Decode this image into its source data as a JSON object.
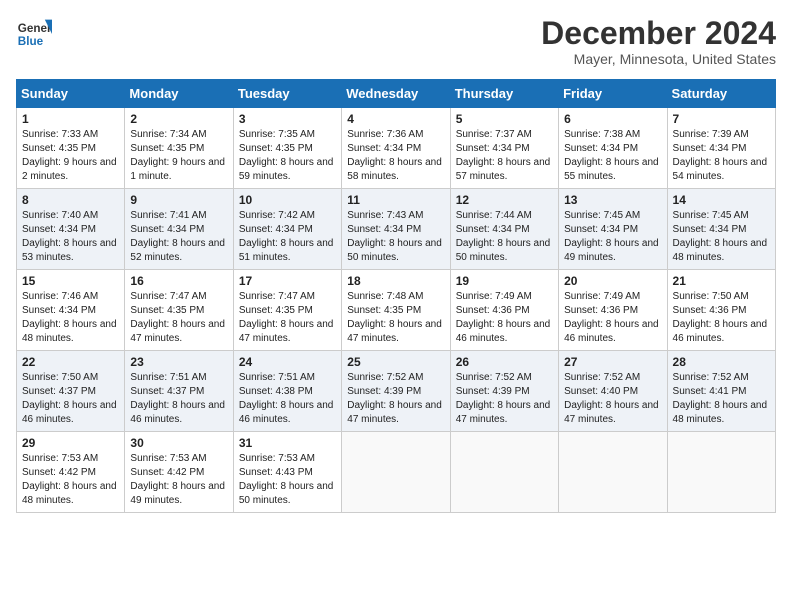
{
  "header": {
    "logo_line1": "General",
    "logo_line2": "Blue",
    "title": "December 2024",
    "subtitle": "Mayer, Minnesota, United States"
  },
  "weekdays": [
    "Sunday",
    "Monday",
    "Tuesday",
    "Wednesday",
    "Thursday",
    "Friday",
    "Saturday"
  ],
  "weeks": [
    [
      {
        "day": "1",
        "sunrise": "Sunrise: 7:33 AM",
        "sunset": "Sunset: 4:35 PM",
        "daylight": "Daylight: 9 hours and 2 minutes."
      },
      {
        "day": "2",
        "sunrise": "Sunrise: 7:34 AM",
        "sunset": "Sunset: 4:35 PM",
        "daylight": "Daylight: 9 hours and 1 minute."
      },
      {
        "day": "3",
        "sunrise": "Sunrise: 7:35 AM",
        "sunset": "Sunset: 4:35 PM",
        "daylight": "Daylight: 8 hours and 59 minutes."
      },
      {
        "day": "4",
        "sunrise": "Sunrise: 7:36 AM",
        "sunset": "Sunset: 4:34 PM",
        "daylight": "Daylight: 8 hours and 58 minutes."
      },
      {
        "day": "5",
        "sunrise": "Sunrise: 7:37 AM",
        "sunset": "Sunset: 4:34 PM",
        "daylight": "Daylight: 8 hours and 57 minutes."
      },
      {
        "day": "6",
        "sunrise": "Sunrise: 7:38 AM",
        "sunset": "Sunset: 4:34 PM",
        "daylight": "Daylight: 8 hours and 55 minutes."
      },
      {
        "day": "7",
        "sunrise": "Sunrise: 7:39 AM",
        "sunset": "Sunset: 4:34 PM",
        "daylight": "Daylight: 8 hours and 54 minutes."
      }
    ],
    [
      {
        "day": "8",
        "sunrise": "Sunrise: 7:40 AM",
        "sunset": "Sunset: 4:34 PM",
        "daylight": "Daylight: 8 hours and 53 minutes."
      },
      {
        "day": "9",
        "sunrise": "Sunrise: 7:41 AM",
        "sunset": "Sunset: 4:34 PM",
        "daylight": "Daylight: 8 hours and 52 minutes."
      },
      {
        "day": "10",
        "sunrise": "Sunrise: 7:42 AM",
        "sunset": "Sunset: 4:34 PM",
        "daylight": "Daylight: 8 hours and 51 minutes."
      },
      {
        "day": "11",
        "sunrise": "Sunrise: 7:43 AM",
        "sunset": "Sunset: 4:34 PM",
        "daylight": "Daylight: 8 hours and 50 minutes."
      },
      {
        "day": "12",
        "sunrise": "Sunrise: 7:44 AM",
        "sunset": "Sunset: 4:34 PM",
        "daylight": "Daylight: 8 hours and 50 minutes."
      },
      {
        "day": "13",
        "sunrise": "Sunrise: 7:45 AM",
        "sunset": "Sunset: 4:34 PM",
        "daylight": "Daylight: 8 hours and 49 minutes."
      },
      {
        "day": "14",
        "sunrise": "Sunrise: 7:45 AM",
        "sunset": "Sunset: 4:34 PM",
        "daylight": "Daylight: 8 hours and 48 minutes."
      }
    ],
    [
      {
        "day": "15",
        "sunrise": "Sunrise: 7:46 AM",
        "sunset": "Sunset: 4:34 PM",
        "daylight": "Daylight: 8 hours and 48 minutes."
      },
      {
        "day": "16",
        "sunrise": "Sunrise: 7:47 AM",
        "sunset": "Sunset: 4:35 PM",
        "daylight": "Daylight: 8 hours and 47 minutes."
      },
      {
        "day": "17",
        "sunrise": "Sunrise: 7:47 AM",
        "sunset": "Sunset: 4:35 PM",
        "daylight": "Daylight: 8 hours and 47 minutes."
      },
      {
        "day": "18",
        "sunrise": "Sunrise: 7:48 AM",
        "sunset": "Sunset: 4:35 PM",
        "daylight": "Daylight: 8 hours and 47 minutes."
      },
      {
        "day": "19",
        "sunrise": "Sunrise: 7:49 AM",
        "sunset": "Sunset: 4:36 PM",
        "daylight": "Daylight: 8 hours and 46 minutes."
      },
      {
        "day": "20",
        "sunrise": "Sunrise: 7:49 AM",
        "sunset": "Sunset: 4:36 PM",
        "daylight": "Daylight: 8 hours and 46 minutes."
      },
      {
        "day": "21",
        "sunrise": "Sunrise: 7:50 AM",
        "sunset": "Sunset: 4:36 PM",
        "daylight": "Daylight: 8 hours and 46 minutes."
      }
    ],
    [
      {
        "day": "22",
        "sunrise": "Sunrise: 7:50 AM",
        "sunset": "Sunset: 4:37 PM",
        "daylight": "Daylight: 8 hours and 46 minutes."
      },
      {
        "day": "23",
        "sunrise": "Sunrise: 7:51 AM",
        "sunset": "Sunset: 4:37 PM",
        "daylight": "Daylight: 8 hours and 46 minutes."
      },
      {
        "day": "24",
        "sunrise": "Sunrise: 7:51 AM",
        "sunset": "Sunset: 4:38 PM",
        "daylight": "Daylight: 8 hours and 46 minutes."
      },
      {
        "day": "25",
        "sunrise": "Sunrise: 7:52 AM",
        "sunset": "Sunset: 4:39 PM",
        "daylight": "Daylight: 8 hours and 47 minutes."
      },
      {
        "day": "26",
        "sunrise": "Sunrise: 7:52 AM",
        "sunset": "Sunset: 4:39 PM",
        "daylight": "Daylight: 8 hours and 47 minutes."
      },
      {
        "day": "27",
        "sunrise": "Sunrise: 7:52 AM",
        "sunset": "Sunset: 4:40 PM",
        "daylight": "Daylight: 8 hours and 47 minutes."
      },
      {
        "day": "28",
        "sunrise": "Sunrise: 7:52 AM",
        "sunset": "Sunset: 4:41 PM",
        "daylight": "Daylight: 8 hours and 48 minutes."
      }
    ],
    [
      {
        "day": "29",
        "sunrise": "Sunrise: 7:53 AM",
        "sunset": "Sunset: 4:42 PM",
        "daylight": "Daylight: 8 hours and 48 minutes."
      },
      {
        "day": "30",
        "sunrise": "Sunrise: 7:53 AM",
        "sunset": "Sunset: 4:42 PM",
        "daylight": "Daylight: 8 hours and 49 minutes."
      },
      {
        "day": "31",
        "sunrise": "Sunrise: 7:53 AM",
        "sunset": "Sunset: 4:43 PM",
        "daylight": "Daylight: 8 hours and 50 minutes."
      },
      null,
      null,
      null,
      null
    ]
  ]
}
